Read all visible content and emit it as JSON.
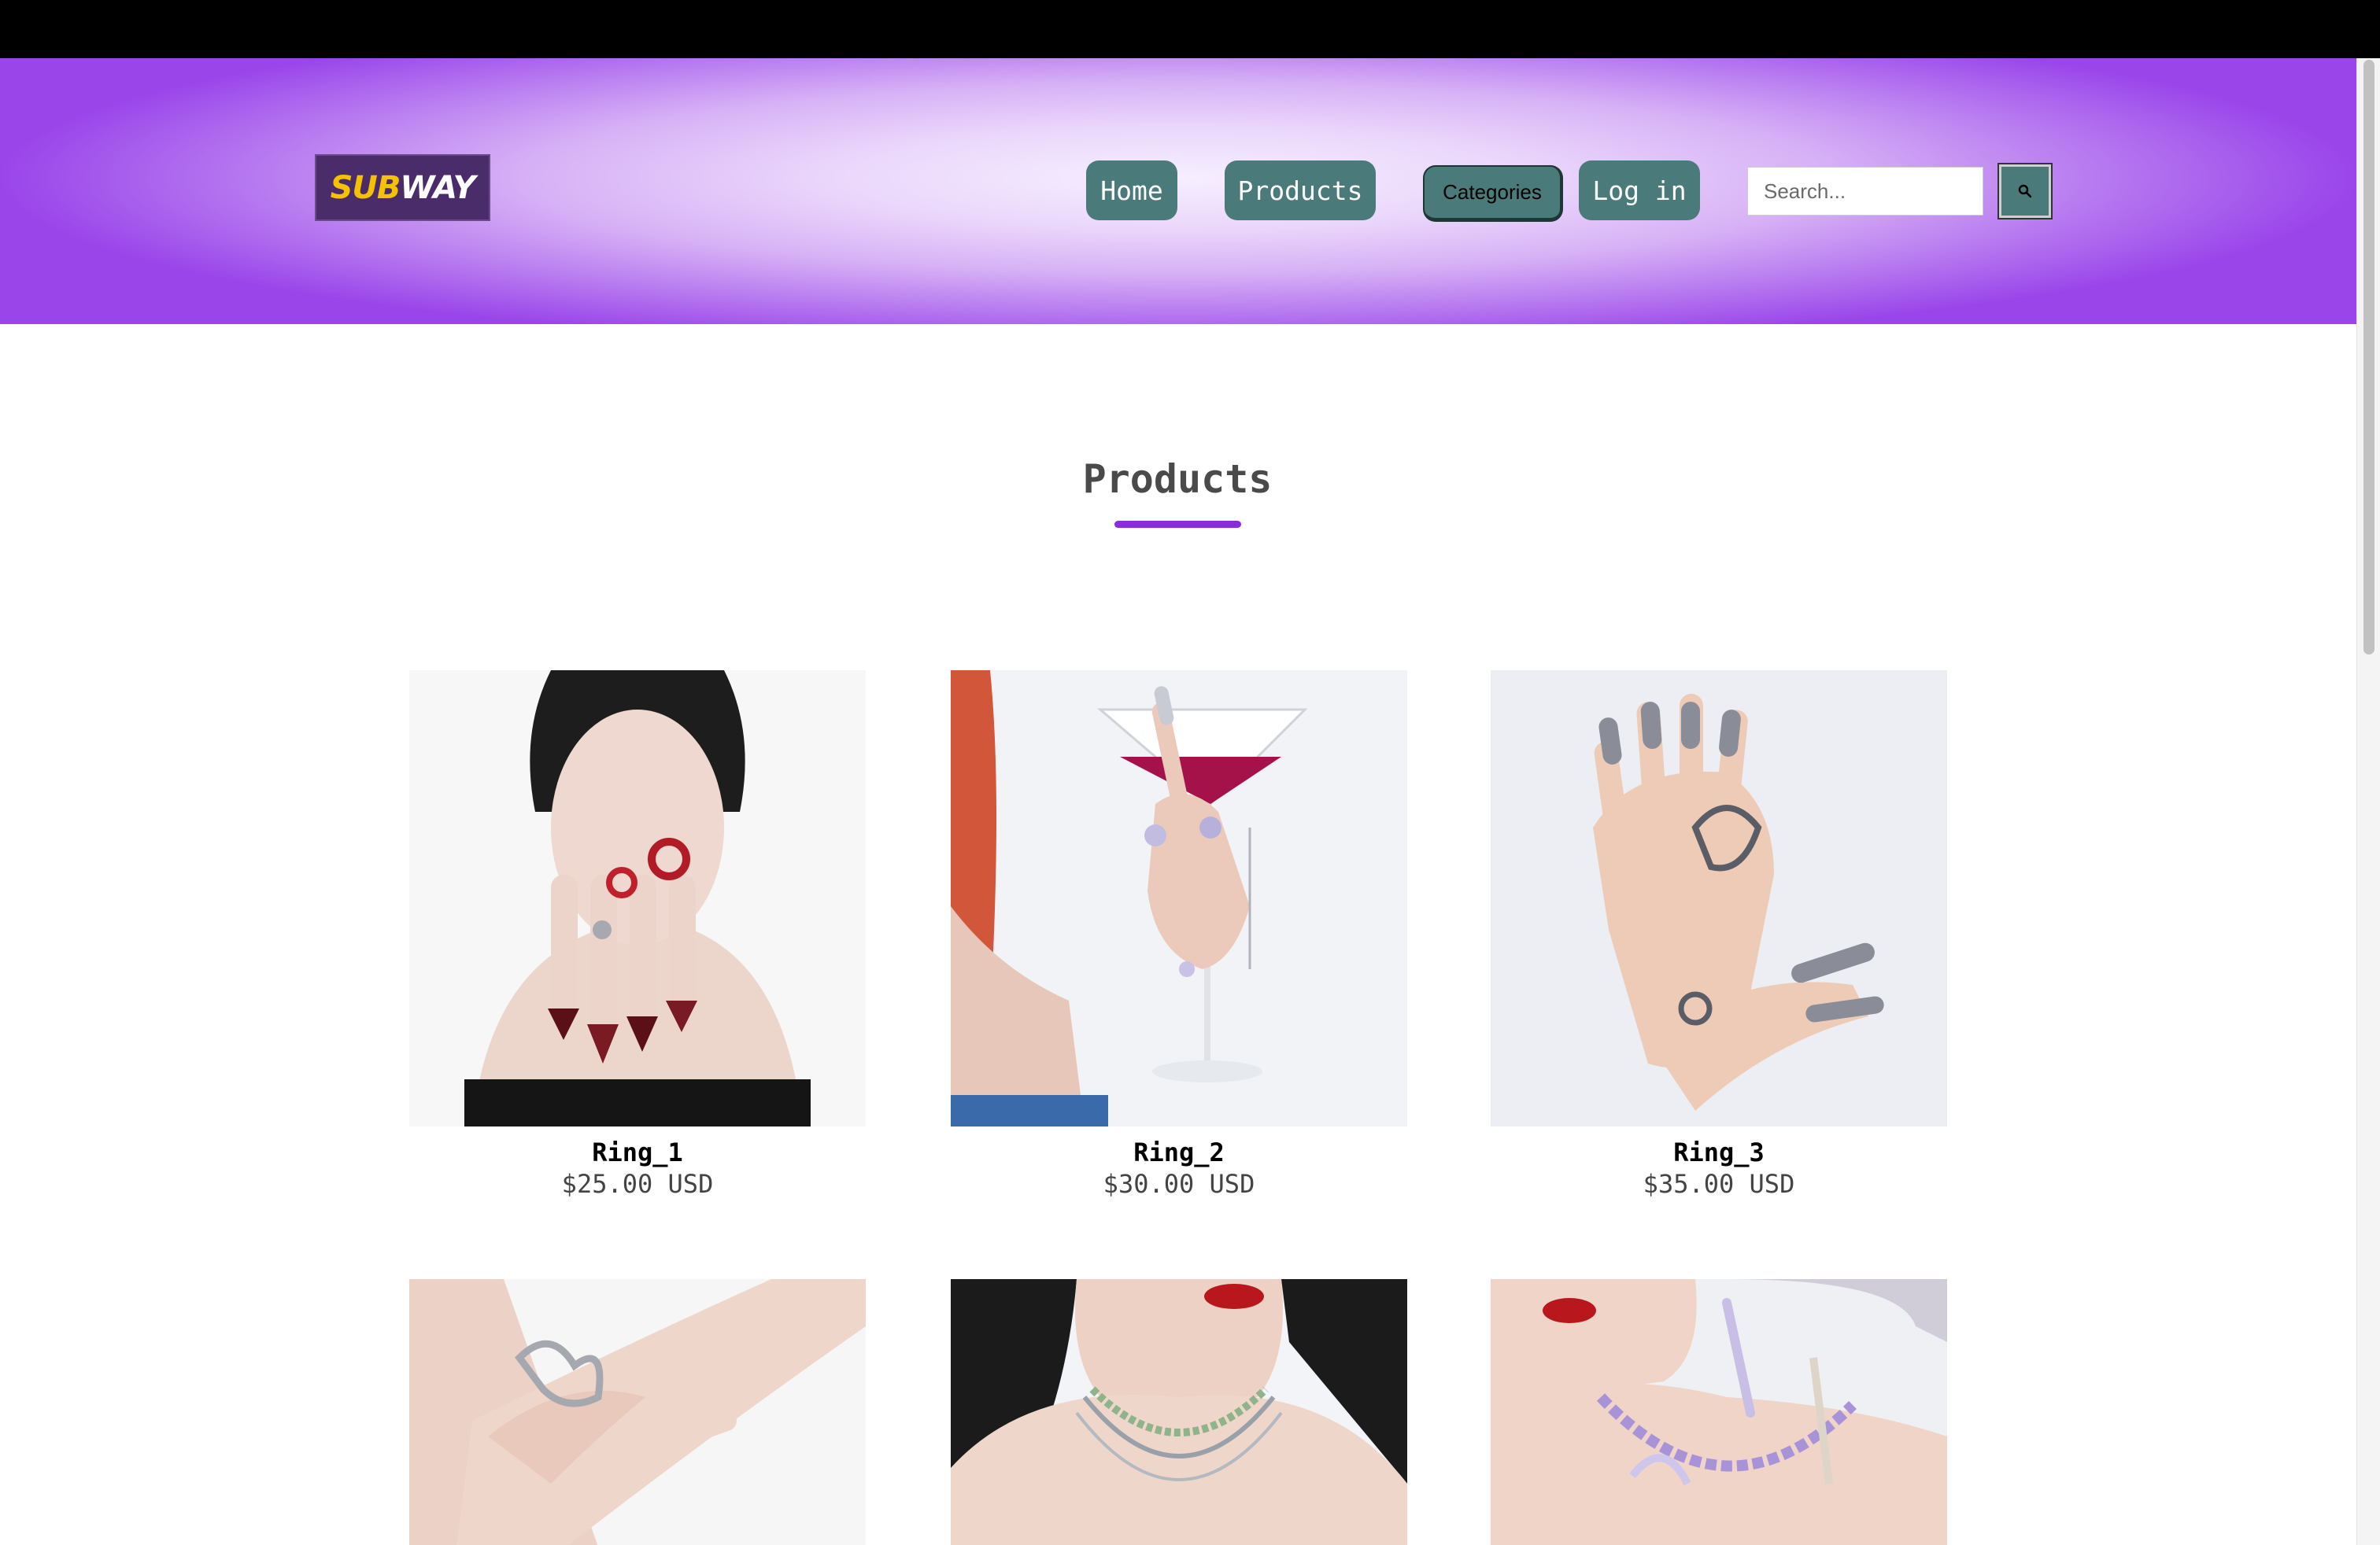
{
  "brand": {
    "logo_sub": "SUB",
    "logo_way": "WAY"
  },
  "nav": {
    "home": "Home",
    "products": "Products",
    "categories": "Categories",
    "login": "Log in"
  },
  "search": {
    "placeholder": "Search...",
    "icon": "search-icon"
  },
  "main": {
    "title": "Products"
  },
  "products": [
    {
      "name": "Ring_1",
      "price": "$25.00 USD"
    },
    {
      "name": "Ring_2",
      "price": "$30.00 USD"
    },
    {
      "name": "Ring_3",
      "price": "$35.00 USD"
    }
  ],
  "colors": {
    "accent": "#8a2be2",
    "button": "#4b7a7a",
    "header_edge": "#9a45ea"
  }
}
